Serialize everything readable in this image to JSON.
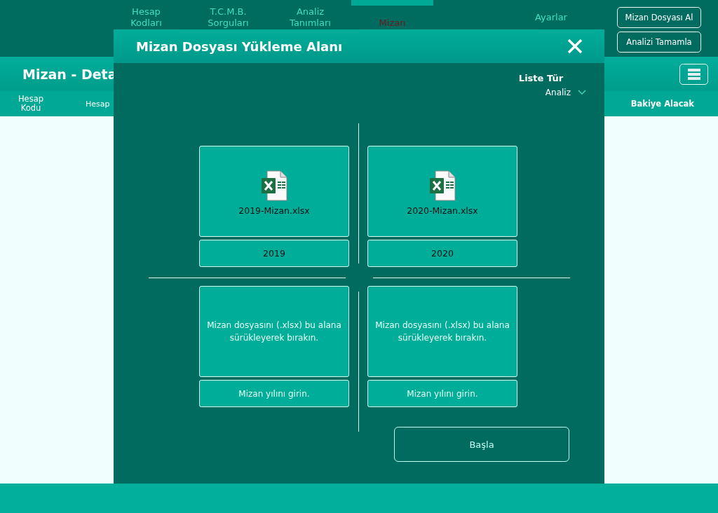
{
  "nav": [
    {
      "label": "Hesap Kodları",
      "selected": false
    },
    {
      "label": "T.C.M.B. Sorguları",
      "selected": false
    },
    {
      "label": "Analiz Tanımları",
      "selected": false
    },
    {
      "label": "Mizan",
      "selected": true
    }
  ],
  "settings_link": "Ayarlar",
  "header_buttons": [
    "Mizan Dosyası Al",
    "Analizi Tamamla"
  ],
  "page_title": "Mizan - Deta",
  "columns": [
    "Hesap Kodu",
    "Hesap",
    "Bakiye Alacak"
  ],
  "dialog": {
    "title": "Mizan Dosyası Yükleme Alanı",
    "list_type": {
      "label": "Liste Tür",
      "value": "Analiz"
    },
    "slots": [
      {
        "kind": "file",
        "file_name": "2019-Mizan.xlsx",
        "year": "2019"
      },
      {
        "kind": "file",
        "file_name": "2020-Mizan.xlsx",
        "year": "2020"
      },
      {
        "kind": "empty",
        "hint": "Mizan dosyasını (.xlsx) bu alana sürükleyerek bırakın.",
        "year_placeholder": "Mizan yılını girin."
      },
      {
        "kind": "empty",
        "hint": "Mizan dosyasını (.xlsx) bu alana sürükleyerek bırakın.",
        "year_placeholder": "Mizan yılını girin."
      }
    ],
    "start_button": "Başla"
  }
}
